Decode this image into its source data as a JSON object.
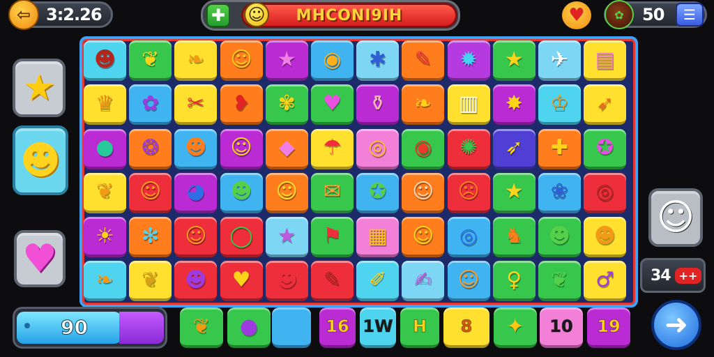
{
  "hud": {
    "back_icon": "arrow-left-icon",
    "timer": "3:2.26",
    "add_icon": "plus-icon",
    "title": "MHCONI9IH",
    "coin_count": "50",
    "menu_icon": "hamburger-menu-icon",
    "accent": "#e3312a"
  },
  "side_left": [
    {
      "name": "star",
      "glyph": "★",
      "bg": "#c7cbd2",
      "fg": "#ffcc14"
    },
    {
      "name": "blob",
      "glyph": "☻",
      "bg": "#6ad7ef",
      "fg": "#ffd31e"
    },
    {
      "name": "heart",
      "glyph": "♥",
      "bg": "#c7cbd2",
      "fg": "#f04fd6"
    }
  ],
  "side_right": {
    "face_icon": "☺",
    "counter": "34",
    "counter_badge": "++"
  },
  "board": {
    "rows": [
      [
        {
          "c": "#4fd4f0",
          "g": "☻",
          "f": "#b3261e"
        },
        {
          "c": "#37c74c",
          "g": "❦",
          "f": "#ffd319"
        },
        {
          "c": "#ffe02e",
          "g": "❧",
          "f": "#f19a18"
        },
        {
          "c": "#ff7d1c",
          "g": "☺",
          "f": "#ffcc1f"
        },
        {
          "c": "#bb2bd4",
          "g": "★",
          "f": "#f07ee7"
        },
        {
          "c": "#3fb4f1",
          "g": "◉",
          "f": "#ffb01a"
        },
        {
          "c": "#7ed6f5",
          "g": "✱",
          "f": "#2f5fd6"
        },
        {
          "c": "#ff7d1c",
          "g": "✎",
          "f": "#ee2f3b"
        },
        {
          "c": "#b53ae0",
          "g": "✹",
          "f": "#43d2f1"
        },
        {
          "c": "#37c74c",
          "g": "★",
          "f": "#ffd319"
        },
        {
          "c": "#7ed6f5",
          "g": "✈",
          "f": "#ffffff"
        },
        {
          "c": "#ffe02e",
          "g": "▤",
          "f": "#f07ec2"
        }
      ],
      [
        {
          "c": "#ffe02e",
          "g": "♛",
          "f": "#f19a18"
        },
        {
          "c": "#3fb4f1",
          "g": "✿",
          "f": "#9d3be0"
        },
        {
          "c": "#ffe02e",
          "g": "✂",
          "f": "#e52c2c"
        },
        {
          "c": "#ff7d1c",
          "g": "❥",
          "f": "#e02424"
        },
        {
          "c": "#37c74c",
          "g": "✾",
          "f": "#ffd319"
        },
        {
          "c": "#37c74c",
          "g": "♥",
          "f": "#e94fe0"
        },
        {
          "c": "#bb2bd4",
          "g": "⚱",
          "f": "#f6b8b4"
        },
        {
          "c": "#ff7d1c",
          "g": "❧",
          "f": "#ffd319"
        },
        {
          "c": "#ffe02e",
          "g": "▥",
          "f": "#ffffff"
        },
        {
          "c": "#bb2bd4",
          "g": "✸",
          "f": "#ffd319"
        },
        {
          "c": "#4fd4f0",
          "g": "♔",
          "f": "#f19a18"
        },
        {
          "c": "#ffe02e",
          "g": "➶",
          "f": "#f06a1c"
        }
      ],
      [
        {
          "c": "#bb2bd4",
          "g": "●",
          "f": "#25c99a"
        },
        {
          "c": "#ff7d1c",
          "g": "❂",
          "f": "#9d3be0"
        },
        {
          "c": "#3fb4f1",
          "g": "☻",
          "f": "#ff7d1c"
        },
        {
          "c": "#bb2bd4",
          "g": "☺",
          "f": "#ffd319"
        },
        {
          "c": "#ff7d1c",
          "g": "◆",
          "f": "#f07ee7"
        },
        {
          "c": "#ffe02e",
          "g": "☂",
          "f": "#ee2f3b"
        },
        {
          "c": "#f27fd8",
          "g": "◎",
          "f": "#ffc316"
        },
        {
          "c": "#37c74c",
          "g": "◉",
          "f": "#e93a2b"
        },
        {
          "c": "#ee2f3b",
          "g": "✺",
          "f": "#37c74c"
        },
        {
          "c": "#4f3fd4",
          "g": "➶",
          "f": "#ffd319"
        },
        {
          "c": "#ff7d1c",
          "g": "✚",
          "f": "#ffd319"
        },
        {
          "c": "#37c74c",
          "g": "✪",
          "f": "#e94fe0"
        }
      ],
      [
        {
          "c": "#ffe02e",
          "g": "❦",
          "f": "#f19a18"
        },
        {
          "c": "#ee2f3b",
          "g": "☺",
          "f": "#ff9a1f"
        },
        {
          "c": "#bb2bd4",
          "g": "◕",
          "f": "#2f6fe6"
        },
        {
          "c": "#3fb4f1",
          "g": "☻",
          "f": "#56d04a"
        },
        {
          "c": "#ff7d1c",
          "g": "☺",
          "f": "#ffe02e"
        },
        {
          "c": "#37c74c",
          "g": "✉",
          "f": "#f6a23a"
        },
        {
          "c": "#3fb4f1",
          "g": "✪",
          "f": "#56d04a"
        },
        {
          "c": "#ff7d1c",
          "g": "☺",
          "f": "#ffd6b0"
        },
        {
          "c": "#ee2f3b",
          "g": "☹",
          "f": "#ff7d1c"
        },
        {
          "c": "#37c74c",
          "g": "★",
          "f": "#ffd319"
        },
        {
          "c": "#3fb4f1",
          "g": "❀",
          "f": "#2f5fd6"
        },
        {
          "c": "#ee2f3b",
          "g": "◎",
          "f": "#b3261e"
        }
      ],
      [
        {
          "c": "#bb2bd4",
          "g": "☀",
          "f": "#ffd319"
        },
        {
          "c": "#ff7d1c",
          "g": "✻",
          "f": "#4fd4f0"
        },
        {
          "c": "#ee2f3b",
          "g": "☺",
          "f": "#ff9a1f"
        },
        {
          "c": "#ee2f3b",
          "g": "◯",
          "f": "#37c74c"
        },
        {
          "c": "#7ed6f5",
          "g": "★",
          "f": "#c058e0"
        },
        {
          "c": "#37c74c",
          "g": "⚑",
          "f": "#ee2f3b"
        },
        {
          "c": "#f27fd8",
          "g": "▦",
          "f": "#ffc316"
        },
        {
          "c": "#ff7d1c",
          "g": "☺",
          "f": "#ffd319"
        },
        {
          "c": "#3fb4f1",
          "g": "◎",
          "f": "#2f6fe6"
        },
        {
          "c": "#37c74c",
          "g": "♞",
          "f": "#ff7d1c"
        },
        {
          "c": "#37c74c",
          "g": "☻",
          "f": "#56d04a"
        },
        {
          "c": "#ffe02e",
          "g": "☻",
          "f": "#f19a18"
        }
      ],
      [
        {
          "c": "#4fd4f0",
          "g": "❧",
          "f": "#f19a18"
        },
        {
          "c": "#ffe02e",
          "g": "❦",
          "f": "#d8a018"
        },
        {
          "c": "#ee2f3b",
          "g": "☻",
          "f": "#9d3be0"
        },
        {
          "c": "#ee2f3b",
          "g": "♥",
          "f": "#ffd319"
        },
        {
          "c": "#ee2f3b",
          "g": "☻",
          "f": "#ee2f3b"
        },
        {
          "c": "#ee2f3b",
          "g": "✎",
          "f": "#b3261e"
        },
        {
          "c": "#4fd4f0",
          "g": "✐",
          "f": "#ffd319"
        },
        {
          "c": "#7ed6f5",
          "g": "✍",
          "f": "#c058e0"
        },
        {
          "c": "#3fb4f1",
          "g": "☺",
          "f": "#ff9a1f"
        },
        {
          "c": "#37c74c",
          "g": "♀",
          "f": "#ffd319"
        },
        {
          "c": "#37c74c",
          "g": "❦",
          "f": "#56d04a"
        },
        {
          "c": "#ffe02e",
          "g": "♂",
          "f": "#9d3be0"
        }
      ]
    ]
  },
  "bottom": {
    "score": "90",
    "tiles": [
      {
        "name": "leaf",
        "bg": "#37c74c",
        "text": "",
        "glyph": "❦",
        "fg": "#f19a18"
      },
      {
        "name": "eggplant",
        "bg": "#37c74c",
        "text": "",
        "glyph": "●",
        "fg": "#9d3be0"
      },
      {
        "name": "blue",
        "bg": "#3fb4f1",
        "text": "",
        "glyph": "",
        "fg": "#fff"
      },
      {
        "name": "num-16",
        "bg": "#bb2bd4",
        "text": "16",
        "glyph": "",
        "fg": "#ffd319"
      },
      {
        "name": "num-1w",
        "bg": "#4fd4f0",
        "text": "1W",
        "glyph": "",
        "fg": "#1a1a1a"
      },
      {
        "name": "num-h",
        "bg": "#37c74c",
        "text": "H",
        "glyph": "",
        "fg": "#ffd319"
      },
      {
        "name": "num-8",
        "bg": "#ffe02e",
        "text": "8",
        "glyph": "",
        "fg": "#e05a10"
      },
      {
        "name": "star-tile",
        "bg": "#37c74c",
        "text": "",
        "glyph": "✦",
        "fg": "#ffc316"
      },
      {
        "name": "num-10",
        "bg": "#f27fd8",
        "text": "10",
        "glyph": "",
        "fg": "#1a1a1a"
      },
      {
        "name": "num-19",
        "bg": "#bb2bd4",
        "text": "19",
        "glyph": "",
        "fg": "#ffd319"
      }
    ],
    "next_icon": "arrow-right-icon"
  }
}
